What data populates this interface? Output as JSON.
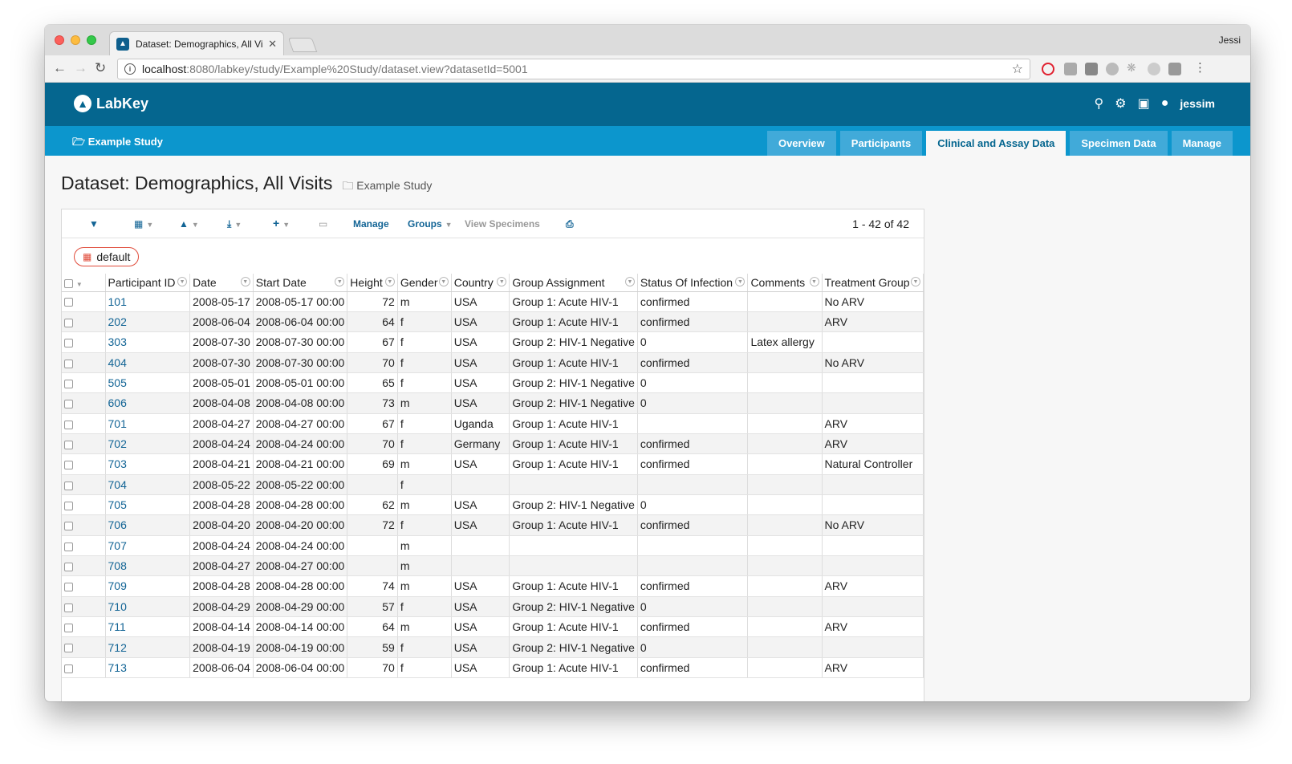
{
  "browser": {
    "tab_title": "Dataset: Demographics, All Vis",
    "profile": "Jessi",
    "url_host": "localhost",
    "url_rest": ":8080/labkey/study/Example%20Study/dataset.view?datasetId=5001"
  },
  "header": {
    "logo": "LabKey",
    "user": "jessim",
    "study_link": "Example Study",
    "tabs": [
      "Overview",
      "Participants",
      "Clinical and Assay Data",
      "Specimen Data",
      "Manage"
    ],
    "active_tab": "Clinical and Assay Data"
  },
  "page": {
    "title": "Dataset: Demographics, All Visits",
    "crumb": "Example Study"
  },
  "toolbar": {
    "manage": "Manage",
    "groups": "Groups",
    "view_specimens": "View Specimens",
    "paging": "1 - 42 of 42",
    "view_name": "default"
  },
  "grid": {
    "columns": [
      "Participant ID",
      "Date",
      "Start Date",
      "Height",
      "Gender",
      "Country",
      "Group Assignment",
      "Status Of Infection",
      "Comments",
      "Treatment Group"
    ],
    "rows": [
      [
        "101",
        "2008-05-17",
        "2008-05-17 00:00",
        "72",
        "m",
        "USA",
        "Group 1: Acute HIV-1",
        "confirmed",
        "",
        "No ARV"
      ],
      [
        "202",
        "2008-06-04",
        "2008-06-04 00:00",
        "64",
        "f",
        "USA",
        "Group 1: Acute HIV-1",
        "confirmed",
        "",
        "ARV"
      ],
      [
        "303",
        "2008-07-30",
        "2008-07-30 00:00",
        "67",
        "f",
        "USA",
        "Group 2: HIV-1 Negative",
        "0",
        "Latex allergy",
        ""
      ],
      [
        "404",
        "2008-07-30",
        "2008-07-30 00:00",
        "70",
        "f",
        "USA",
        "Group 1: Acute HIV-1",
        "confirmed",
        "",
        "No ARV"
      ],
      [
        "505",
        "2008-05-01",
        "2008-05-01 00:00",
        "65",
        "f",
        "USA",
        "Group 2: HIV-1 Negative",
        "0",
        "",
        ""
      ],
      [
        "606",
        "2008-04-08",
        "2008-04-08 00:00",
        "73",
        "m",
        "USA",
        "Group 2: HIV-1 Negative",
        "0",
        "",
        ""
      ],
      [
        "701",
        "2008-04-27",
        "2008-04-27 00:00",
        "67",
        "f",
        "Uganda",
        "Group 1: Acute HIV-1",
        "",
        "",
        "ARV"
      ],
      [
        "702",
        "2008-04-24",
        "2008-04-24 00:00",
        "70",
        "f",
        "Germany",
        "Group 1: Acute HIV-1",
        "confirmed",
        "",
        "ARV"
      ],
      [
        "703",
        "2008-04-21",
        "2008-04-21 00:00",
        "69",
        "m",
        "USA",
        "Group 1: Acute HIV-1",
        "confirmed",
        "",
        "Natural Controller"
      ],
      [
        "704",
        "2008-05-22",
        "2008-05-22 00:00",
        "",
        "f",
        "",
        "",
        "",
        "",
        ""
      ],
      [
        "705",
        "2008-04-28",
        "2008-04-28 00:00",
        "62",
        "m",
        "USA",
        "Group 2: HIV-1 Negative",
        "0",
        "",
        ""
      ],
      [
        "706",
        "2008-04-20",
        "2008-04-20 00:00",
        "72",
        "f",
        "USA",
        "Group 1: Acute HIV-1",
        "confirmed",
        "",
        "No ARV"
      ],
      [
        "707",
        "2008-04-24",
        "2008-04-24 00:00",
        "",
        "m",
        "",
        "",
        "",
        "",
        ""
      ],
      [
        "708",
        "2008-04-27",
        "2008-04-27 00:00",
        "",
        "m",
        "",
        "",
        "",
        "",
        ""
      ],
      [
        "709",
        "2008-04-28",
        "2008-04-28 00:00",
        "74",
        "m",
        "USA",
        "Group 1: Acute HIV-1",
        "confirmed",
        "",
        "ARV"
      ],
      [
        "710",
        "2008-04-29",
        "2008-04-29 00:00",
        "57",
        "f",
        "USA",
        "Group 2: HIV-1 Negative",
        "0",
        "",
        ""
      ],
      [
        "711",
        "2008-04-14",
        "2008-04-14 00:00",
        "64",
        "m",
        "USA",
        "Group 1: Acute HIV-1",
        "confirmed",
        "",
        "ARV"
      ],
      [
        "712",
        "2008-04-19",
        "2008-04-19 00:00",
        "59",
        "f",
        "USA",
        "Group 2: HIV-1 Negative",
        "0",
        "",
        ""
      ],
      [
        "713",
        "2008-06-04",
        "2008-06-04 00:00",
        "70",
        "f",
        "USA",
        "Group 1: Acute HIV-1",
        "confirmed",
        "",
        "ARV"
      ]
    ]
  }
}
